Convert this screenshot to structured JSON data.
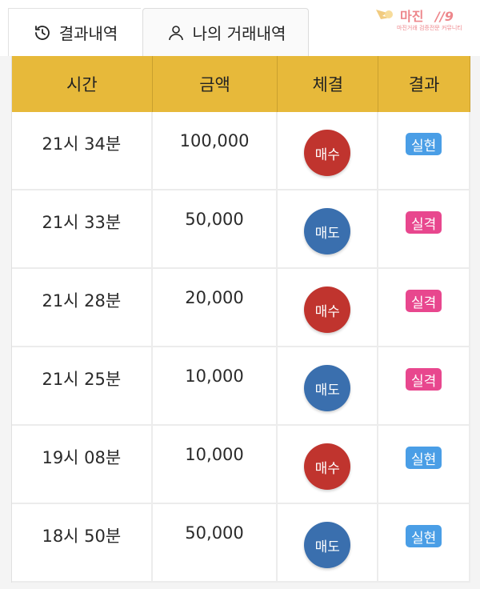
{
  "tabs": [
    {
      "label": "결과내역",
      "icon": "history-icon"
    },
    {
      "label": "나의 거래내역",
      "icon": "person-icon"
    }
  ],
  "logo": {
    "text": "마진",
    "sub": "마진거래 검증전문 커뮤니티"
  },
  "table": {
    "headers": [
      "시간",
      "금액",
      "체결",
      "결과"
    ],
    "rows": [
      {
        "time": "21시 34분",
        "amount": "100,000",
        "trade": "매수",
        "result": "실현"
      },
      {
        "time": "21시 33분",
        "amount": "50,000",
        "trade": "매도",
        "result": "실격"
      },
      {
        "time": "21시 28분",
        "amount": "20,000",
        "trade": "매수",
        "result": "실격"
      },
      {
        "time": "21시 25분",
        "amount": "10,000",
        "trade": "매도",
        "result": "실격"
      },
      {
        "time": "19시 08분",
        "amount": "10,000",
        "trade": "매수",
        "result": "실현"
      },
      {
        "time": "18시 50분",
        "amount": "50,000",
        "trade": "매도",
        "result": "실현"
      }
    ]
  },
  "colors": {
    "header_bg": "#e7b93a",
    "buy": "#c0342e",
    "sell": "#3a6fae",
    "realized": "#4a9ee6",
    "disqualified": "#e8478e"
  }
}
